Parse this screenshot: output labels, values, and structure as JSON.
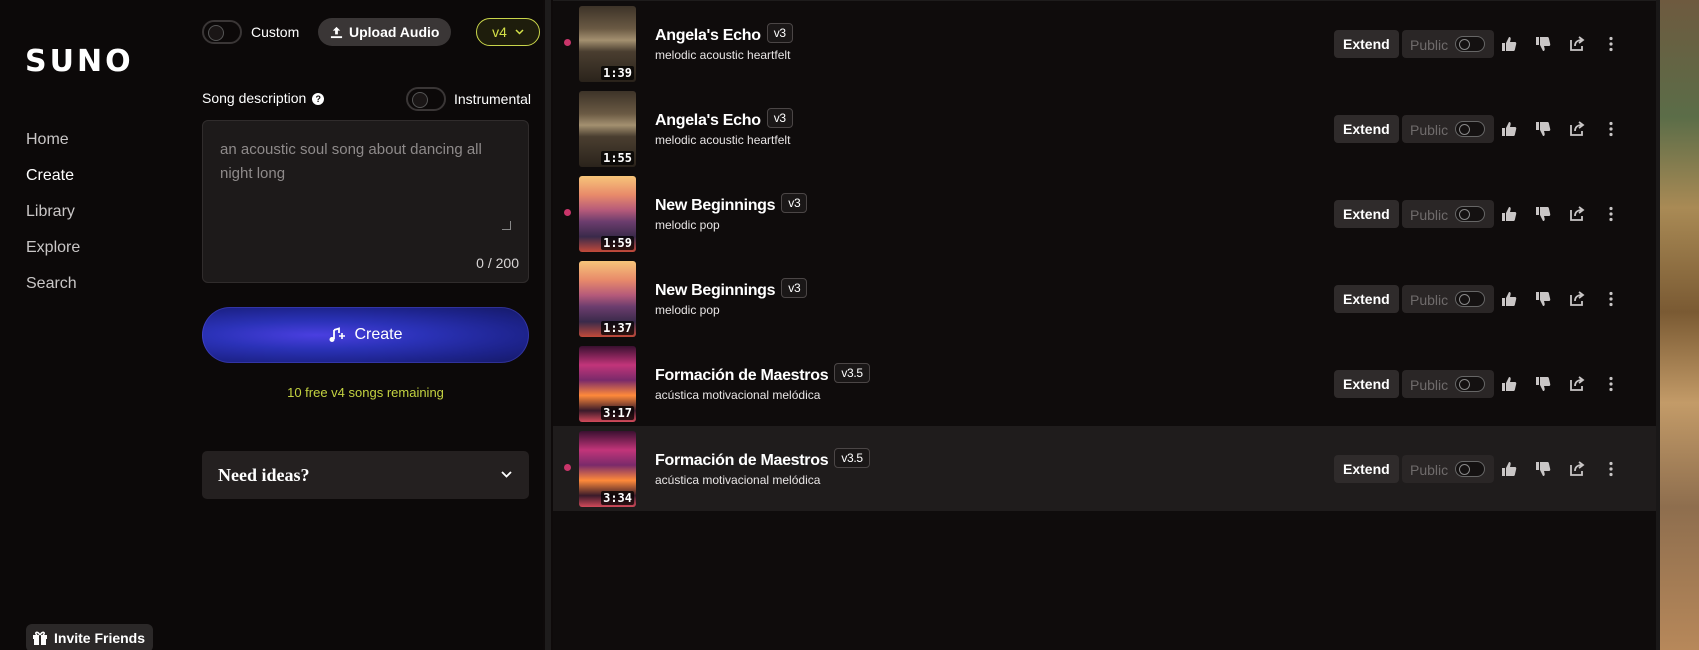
{
  "brand": "SUNO",
  "nav": {
    "items": [
      {
        "label": "Home"
      },
      {
        "label": "Create"
      },
      {
        "label": "Library"
      },
      {
        "label": "Explore"
      },
      {
        "label": "Search"
      }
    ],
    "active": "Create",
    "invite_label": "Invite Friends"
  },
  "create_panel": {
    "custom_label": "Custom",
    "custom_on": false,
    "upload_label": "Upload Audio",
    "version": "v4",
    "description_label": "Song description",
    "instrumental_label": "Instrumental",
    "instrumental_on": false,
    "placeholder": "an acoustic soul song about dancing all night long",
    "counter": "0 / 200",
    "create_label": "Create",
    "free_note": "10 free v4 songs remaining",
    "ideas_label": "Need ideas?"
  },
  "songs": [
    {
      "title": "Angela's Echo",
      "version": "v3",
      "tags": "melodic acoustic heartfelt",
      "duration": "1:39",
      "unread": true,
      "art": "abandoned-room"
    },
    {
      "title": "Angela's Echo",
      "version": "v3",
      "tags": "melodic acoustic heartfelt",
      "duration": "1:55",
      "unread": false,
      "art": "abandoned-room"
    },
    {
      "title": "New Beginnings",
      "version": "v3",
      "tags": "melodic pop",
      "duration": "1:59",
      "unread": true,
      "art": "city-sunset"
    },
    {
      "title": "New Beginnings",
      "version": "v3",
      "tags": "melodic pop",
      "duration": "1:37",
      "unread": false,
      "art": "city-sunset"
    },
    {
      "title": "Formación de Maestros",
      "version": "v3.5",
      "tags": "acústica motivacional melódica",
      "duration": "3:17",
      "unread": false,
      "art": "neon-room"
    },
    {
      "title": "Formación de Maestros",
      "version": "v3.5",
      "tags": "acústica motivacional melódica",
      "duration": "3:34",
      "unread": true,
      "art": "neon-room"
    }
  ],
  "song_actions": {
    "extend_label": "Extend",
    "public_label": "Public"
  },
  "colors": {
    "accent_lime": "#d4e148",
    "unread_dot": "#c9356a",
    "create_gradient": "#2b32b8"
  }
}
